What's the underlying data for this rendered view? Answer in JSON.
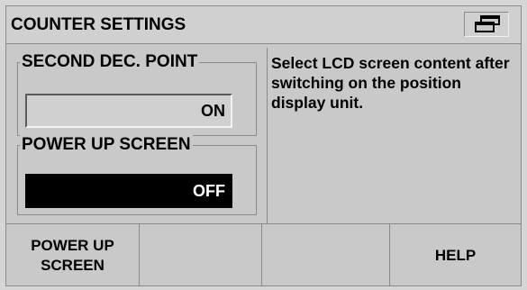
{
  "header": {
    "title": "COUNTER SETTINGS",
    "icon": "window-toggle-icon"
  },
  "settings": {
    "second_dec_point": {
      "label": "SECOND DEC. POINT",
      "value": "ON"
    },
    "power_up_screen": {
      "label": "POWER UP SCREEN",
      "value": "OFF"
    }
  },
  "help_text": "Select LCD screen content after switching on the position display unit.",
  "softkeys": [
    {
      "line1": "POWER UP",
      "line2": "SCREEN"
    },
    {
      "line1": "",
      "line2": ""
    },
    {
      "line1": "",
      "line2": ""
    },
    {
      "line1": "HELP",
      "line2": ""
    }
  ],
  "colors": {
    "background": "#c9c9c9",
    "selected_field": "#000000",
    "selected_text": "#ffffff"
  }
}
